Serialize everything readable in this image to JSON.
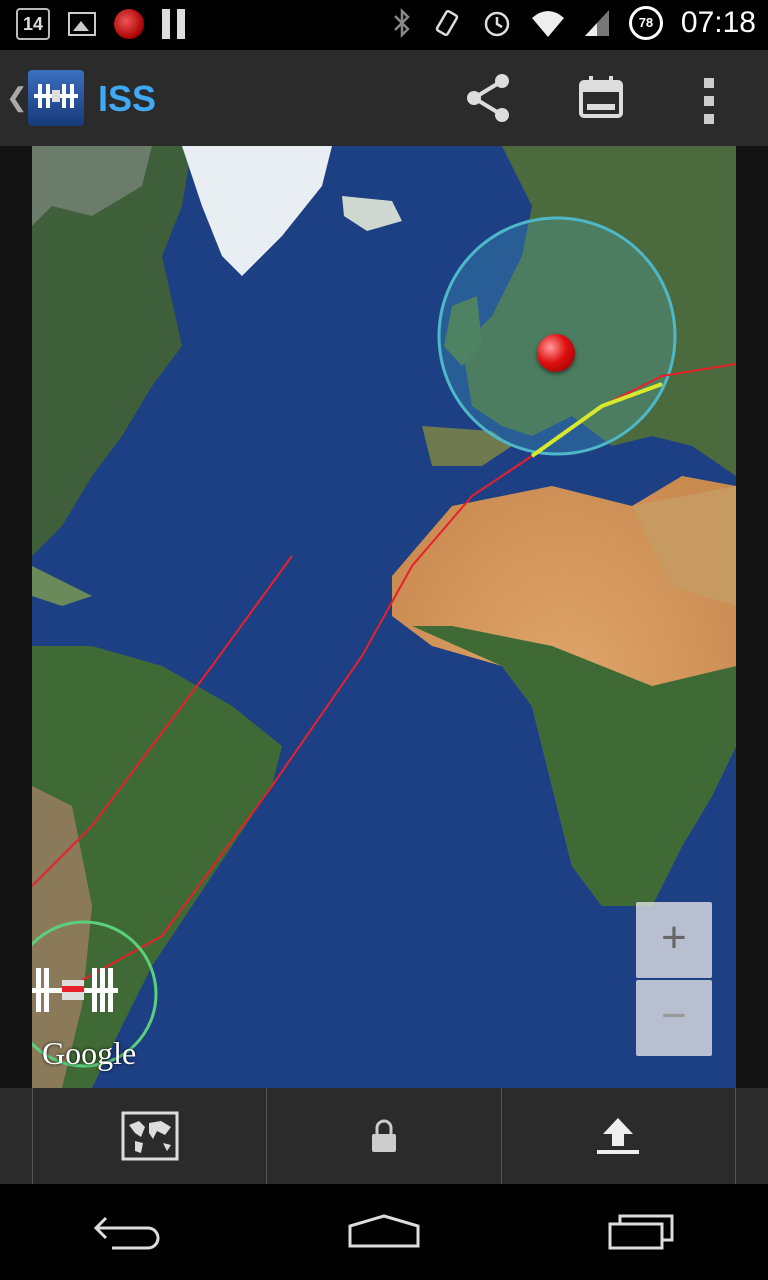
{
  "status_bar": {
    "calendar_day": "14",
    "time": "07:18",
    "battery_level": "78"
  },
  "app_bar": {
    "title": "ISS"
  },
  "map": {
    "attribution": "Google",
    "zoom_in_label": "+",
    "zoom_out_label": "−",
    "track_color": "#e8202a",
    "visible_pass_color": "#d8e82a",
    "marker_color": "#e01010",
    "visibility_circle_color": "#4fb8c8",
    "iss_circle_color": "#5bd07a"
  },
  "icons": {
    "share": "share-icon",
    "calendar": "calendar-icon",
    "more": "overflow-menu-icon",
    "map_type": "map-icon",
    "lock": "lock-icon",
    "upload": "upload-icon",
    "nav_back": "back-icon",
    "nav_home": "home-icon",
    "nav_recents": "recents-icon"
  }
}
